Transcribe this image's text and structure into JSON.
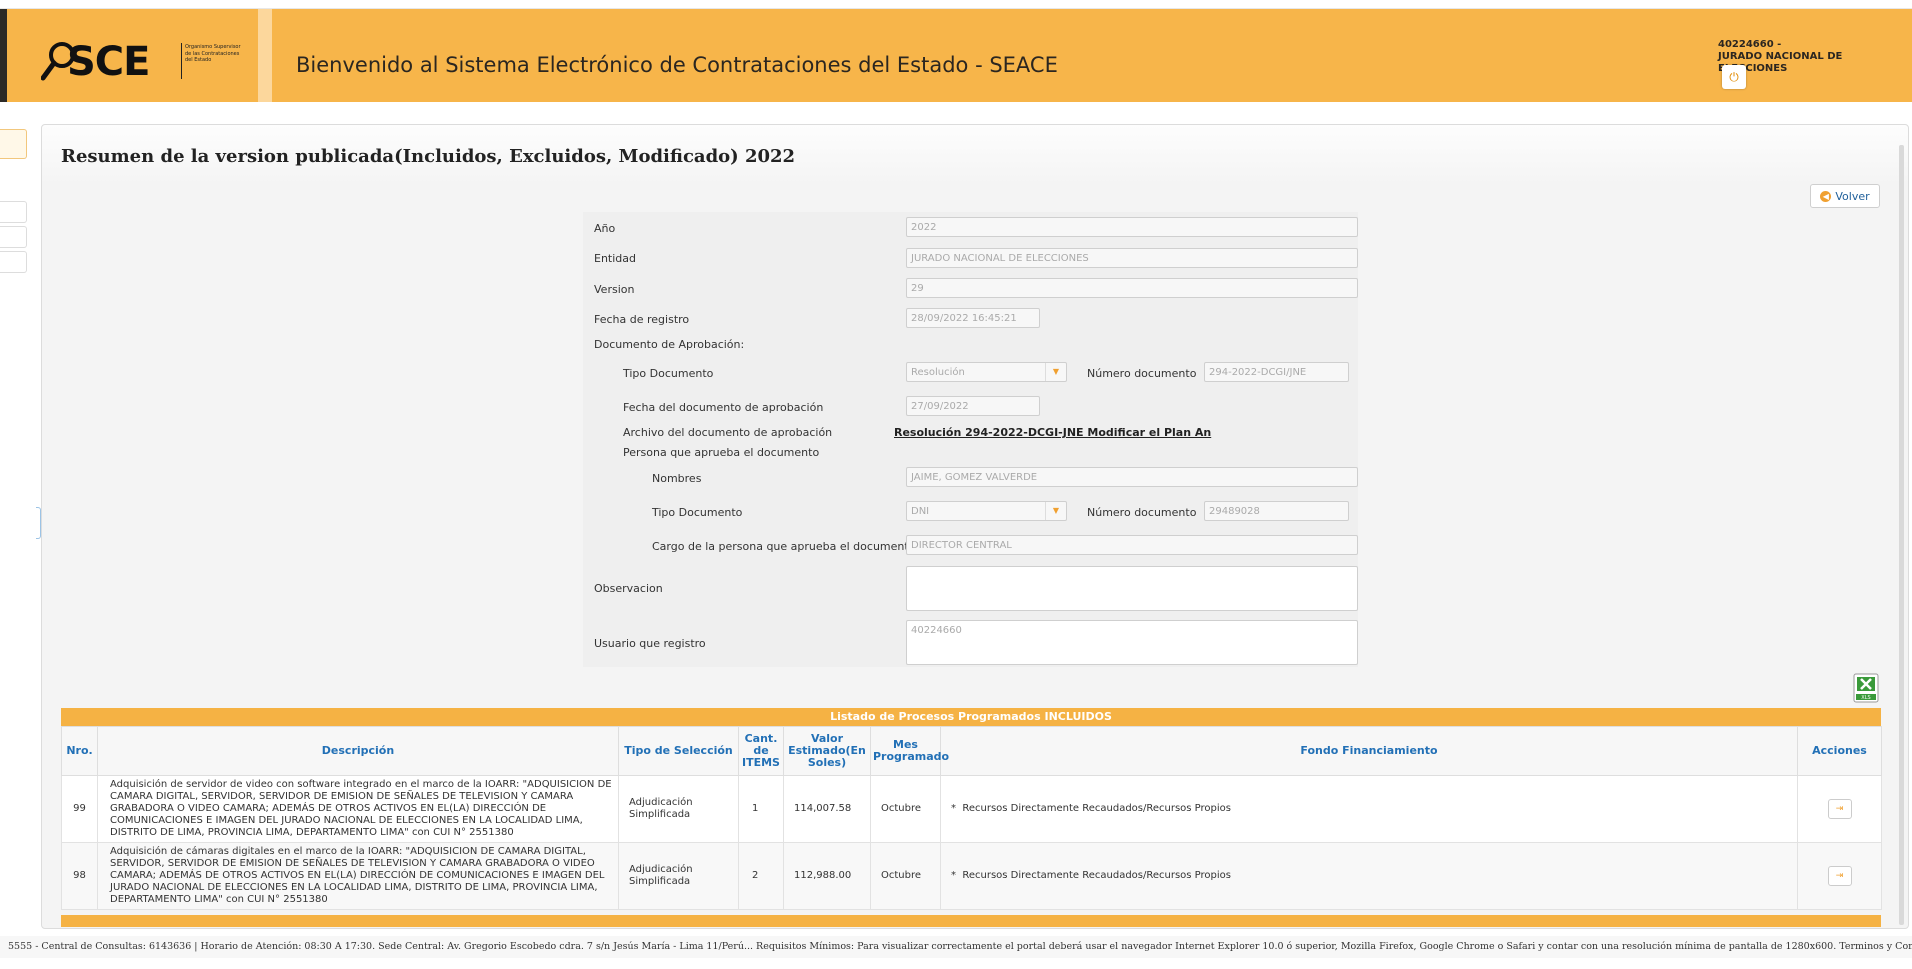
{
  "header": {
    "logo_text": "SCE",
    "logo_subtitle": "Organismo Supervisor de las Contrataciones del Estado",
    "title": "Bienvenido al Sistema Electrónico de Contrataciones del Estado - SEACE",
    "user_id": "40224660 -",
    "user_entity": "JURADO NACIONAL DE ELECCIONES",
    "power_icon": "power-icon"
  },
  "page": {
    "title": "Resumen de la version publicada(Incluidos, Excluidos, Modificado) 2022",
    "volver_label": "Volver"
  },
  "form": {
    "anio_label": "Año",
    "anio_value": "2022",
    "entidad_label": "Entidad",
    "entidad_value": "JURADO NACIONAL DE ELECCIONES",
    "version_label": "Version",
    "version_value": "29",
    "fecha_label": "Fecha de registro",
    "fecha_value": "28/09/2022 16:45:21",
    "doc_aprob_label": "Documento de Aprobación:",
    "tipo_doc_label": "Tipo Documento",
    "tipo_doc_value": "Resolución",
    "num_doc_label": "Número documento",
    "num_doc_value": "294-2022-DCGI/JNE",
    "fecha_doc_label": "Fecha del documento de aprobación",
    "fecha_doc_value": "27/09/2022",
    "archivo_label": "Archivo del documento de aprobación",
    "archivo_value": "Resolución 294-2022-DCGI-JNE Modificar el Plan An",
    "persona_label": "Persona que aprueba el documento",
    "nombres_label": "Nombres",
    "nombres_value": "JAIME, GOMEZ VALVERDE",
    "persona_tipo_doc_label": "Tipo Documento",
    "persona_tipo_doc_value": "DNI",
    "persona_num_doc_label": "Número documento",
    "persona_num_doc_value": "29489028",
    "cargo_label": "Cargo de la persona que aprueba el documento",
    "cargo_value": "DIRECTOR CENTRAL",
    "observacion_label": "Observacion",
    "observacion_value": "",
    "usuario_label": "Usuario que registro",
    "usuario_value": "40224660"
  },
  "table": {
    "caption": "Listado de Procesos Programados INCLUIDOS",
    "headers": [
      "Nro.",
      "Descripción",
      "Tipo de Selección",
      "Cant. de ITEMS",
      "Valor Estimado(En Soles)",
      "Mes Programado",
      "Fondo Financiamiento",
      "Acciones"
    ],
    "rows": [
      {
        "nro": "99",
        "descripcion": "Adquisición de servidor de video con software integrado en el marco de la IOARR: \"ADQUISICION DE CAMARA DIGITAL, SERVIDOR, SERVIDOR DE EMISION DE SEÑALES DE TELEVISION Y CAMARA GRABADORA O VIDEO CAMARA; ADEMÁS DE OTROS ACTIVOS EN EL(LA) DIRECCIÓN DE COMUNICACIONES E IMAGEN DEL JURADO NACIONAL DE ELECCIONES EN LA LOCALIDAD LIMA, DISTRITO DE LIMA, PROVINCIA LIMA, DEPARTAMENTO LIMA\" con CUI N° 2551380",
        "tipo": "Adjudicación Simplificada",
        "cant": "1",
        "valor": "114,007.58",
        "mes": "Octubre",
        "fondo": "Recursos Directamente Recaudados/Recursos Propios"
      },
      {
        "nro": "98",
        "descripcion": "Adquisición de cámaras digitales en el marco de la IOARR: \"ADQUISICION DE CAMARA DIGITAL, SERVIDOR, SERVIDOR DE EMISION DE SEÑALES DE TELEVISION Y CAMARA GRABADORA O VIDEO CAMARA; ADEMÁS DE OTROS ACTIVOS EN EL(LA) DIRECCIÓN DE COMUNICACIONES E IMAGEN DEL JURADO NACIONAL DE ELECCIONES EN LA LOCALIDAD LIMA, DISTRITO DE LIMA, PROVINCIA LIMA, DEPARTAMENTO LIMA\" con CUI N° 2551380",
        "tipo": "Adjudicación Simplificada",
        "cant": "2",
        "valor": "112,988.00",
        "mes": "Octubre",
        "fondo": "Recursos Directamente Recaudados/Recursos Propios"
      }
    ],
    "bullet": "*"
  },
  "footer": {
    "text": "5555 - Central de Consultas: 6143636 | Horario de Atención: 08:30 A 17:30. Sede Central: Av. Gregorio Escobedo cdra. 7 s/n Jesús María - Lima 11/Perú... Requisitos Mínimos: Para visualizar correctamente el portal deberá usar el navegador Internet Explorer 10.0 ó superior, Mozilla Firefox, Google Chrome o Safari y contar con una resolución mínima de pantalla de 1280x600. Terminos y Condiciones de uso"
  }
}
